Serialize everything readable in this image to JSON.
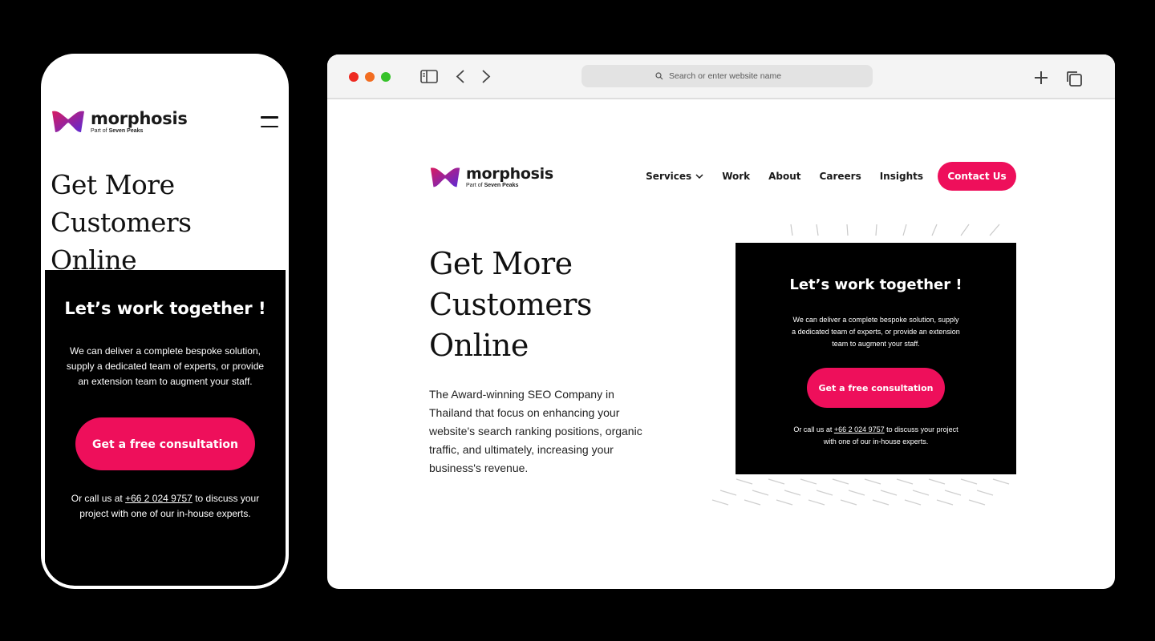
{
  "brand": {
    "name": "morphosis",
    "sub_prefix": "Part of ",
    "sub_bold": "Seven Peaks",
    "colors": {
      "accent": "#ee0f5b",
      "logo_start": "#c2185b",
      "logo_end": "#5b2bd6"
    }
  },
  "phone": {
    "title_line1": "Get More",
    "title_line2": "Customers Online",
    "menu_icon": "hamburger-icon"
  },
  "browser": {
    "address_placeholder": "Search or enter website name",
    "icons": [
      "sidebar-icon",
      "back-icon",
      "forward-icon",
      "search-icon",
      "new-tab-icon",
      "tabs-icon"
    ],
    "nav": {
      "services": "Services",
      "work": "Work",
      "about": "About",
      "careers": "Careers",
      "insights": "Insights",
      "contact": "Contact Us"
    },
    "hero": {
      "line1": "Get More",
      "line2": "Customers",
      "line3": "Online",
      "text": "The Award-winning SEO Company in Thailand that focus on enhancing your website's search ranking positions, organic traffic, and ultimately, increasing your business's revenue."
    }
  },
  "card": {
    "title": "Let’s work together !",
    "description": "We can deliver a complete bespoke solution, supply a dedicated team of experts, or provide an extension team to augment your staff.",
    "button": "Get a free consultation",
    "call_prefix": "Or call us at ",
    "phone_number": "+66 2 024 9757",
    "call_suffix": " to discuss your project with one of our in-house experts."
  }
}
